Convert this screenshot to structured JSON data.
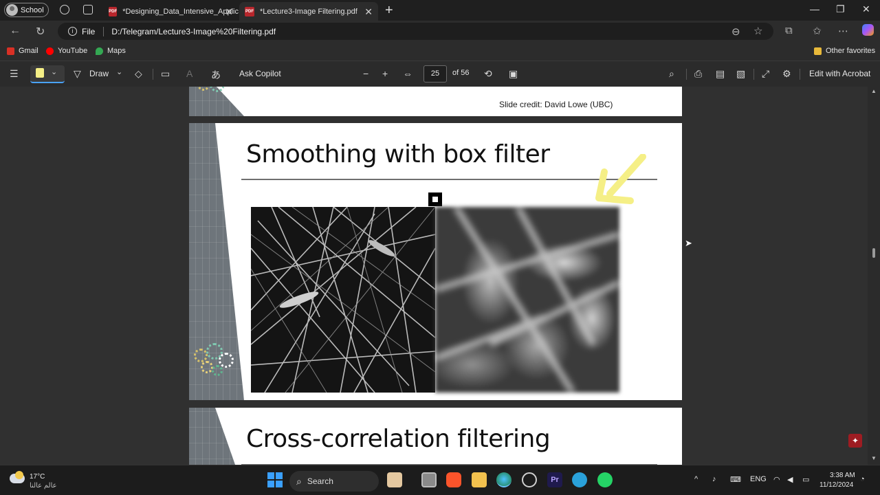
{
  "browser": {
    "profile_label": "School",
    "tabs": [
      {
        "title": "*Designing_Data_Intensive_Applic",
        "active": false
      },
      {
        "title": "*Lecture3-Image Filtering.pdf",
        "active": true
      }
    ],
    "address": {
      "scheme_label": "File",
      "url": "D:/Telegram/Lecture3-Image%20Filtering.pdf"
    },
    "favorites": [
      {
        "label": "Gmail",
        "color": "#d93025"
      },
      {
        "label": "YouTube",
        "color": "#ff0000"
      },
      {
        "label": "Maps",
        "color": "#34a853"
      }
    ],
    "other_favorites": "Other favorites"
  },
  "pdf_toolbar": {
    "draw_label": "Draw",
    "copilot_label": "Ask Copilot",
    "page_current": "25",
    "page_total": "of 56",
    "acrobat_label": "Edit with Acrobat"
  },
  "slides": {
    "prev_credit": "Slide credit: David Lowe (UBC)",
    "current_title": "Smoothing with box filter",
    "next_title": "Cross-correlation filtering"
  },
  "taskbar": {
    "weather_temp": "17°C",
    "weather_desc": "عالم عالنا",
    "search_label": "Search",
    "lang": "ENG",
    "time": "3:38 AM",
    "date": "11/12/2024"
  },
  "colors": {
    "accent_yellow": "#f5ef86",
    "pdf_red": "#b8262c"
  }
}
